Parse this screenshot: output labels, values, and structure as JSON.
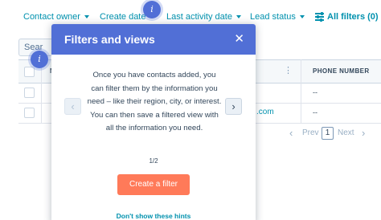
{
  "filters": {
    "contact_owner": "Contact owner",
    "create_date": "Create date",
    "last_activity_date": "Last activity date",
    "lead_status": "Lead status",
    "all_filters": "All filters (0)"
  },
  "beacon_label": "i",
  "search": {
    "value": "Sear"
  },
  "table": {
    "header_n": "N",
    "header_dots": "⋮",
    "phone_header": "PHONE NUMBER",
    "rows": [
      {
        "email": "",
        "phone": "--"
      },
      {
        "email": ".com",
        "phone": "--"
      }
    ]
  },
  "pagination": {
    "prev_icon": "‹",
    "prev": "Prev",
    "page": "1",
    "next": "Next",
    "next_icon": "›"
  },
  "dialog": {
    "title": "Filters and views",
    "close_icon": "✕",
    "body": "Once you have contacts added, you can filter them by the information you need – like their region, city, or interest. You can then save a filtered view with all the information you need.",
    "prev_icon": "‹",
    "next_icon": "›",
    "counter": "1/2",
    "cta": "Create a filter",
    "dont_show": "Don't show these hints"
  },
  "colors": {
    "accent": "#0091ae",
    "dialog_header": "#516fd6",
    "cta": "#ff7a59"
  }
}
